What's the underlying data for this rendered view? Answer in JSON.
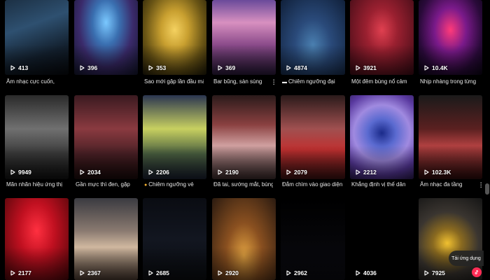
{
  "tiles": [
    {
      "views": "413",
      "caption": "Âm nhạc cực cuốn,",
      "caption_icon": "",
      "bg": "linear-gradient(160deg,#1c3044 0%,#2e5070 35%,#13202e 70%,#07090d 100%)"
    },
    {
      "views": "396",
      "caption": "",
      "caption_icon": "",
      "bg": "radial-gradient(ellipse at 50% 30%,#7ac8ff 0%,#3a6fb0 30%,#3a2a6a 60%,#12152a 100%)"
    },
    {
      "views": "353",
      "caption": "Sao mới gặp lần đầu mà",
      "caption_icon": "",
      "bg": "radial-gradient(ellipse at 50% 40%,#f4d160 0%,#c9a030 30%,#6a5515 65%,#1f1a08 100%)"
    },
    {
      "views": "369",
      "caption": "Bar bũng, sàn sùng",
      "caption_icon": "",
      "bg": "linear-gradient(180deg,#6a4a9a 0%,#d890c0 30%,#8a4a8a 60%,#2a1a3a 100%)"
    },
    {
      "views": "4874",
      "caption": "Chiêm ngưỡng đại",
      "caption_icon": "club",
      "bg": "radial-gradient(ellipse at 50% 60%,#4a7fb0 0%,#2a4a7a 40%,#10203a 100%)"
    },
    {
      "views": "3921",
      "caption": "Một đêm bùng nổ cảm",
      "caption_icon": "",
      "bg": "radial-gradient(ellipse at 50% 40%,#e04050 0%,#9a2030 35%,#3a0a14 100%)"
    },
    {
      "views": "10.4K",
      "caption": "Nhịp nhàng trong từng",
      "caption_icon": "",
      "bg": "radial-gradient(ellipse at 50% 40%,#ff3a7a 0%,#7a1a8a 35%,#2a0a3a 70%,#0a0412 100%)"
    },
    {
      "views": "9949",
      "caption": "Mãn nhãn hiệu ứng thị",
      "caption_icon": "",
      "bg": "linear-gradient(180deg,#2a2a2a 0%,#707070 40%,#3a3a3a 70%,#111 100%)"
    },
    {
      "views": "2034",
      "caption": "Gần mực thì đen, gặp",
      "caption_icon": "",
      "bg": "linear-gradient(180deg,#3a1a20 0%,#8a3a40 40%,#4a2025 70%,#1a0a0a 100%)"
    },
    {
      "views": "2206",
      "caption": "Chiêm ngưỡng vẻ",
      "caption_icon": "emoji",
      "bg": "linear-gradient(180deg,#2a3550 0%,#c8d060 40%,#4a6040 70%,#1a2030 100%)"
    },
    {
      "views": "2190",
      "caption": "Đã tai, sướng mắt, bùng",
      "caption_icon": "",
      "bg": "linear-gradient(180deg,#2a1a1a 0%,#8a4040 35%,#d0a0a0 60%,#3a2a2a 100%)"
    },
    {
      "views": "2079",
      "caption": "Đắm chìm vào giao diện",
      "caption_icon": "",
      "bg": "linear-gradient(180deg,#2a1a1a 0%,#a05050 40%,#c03030 65%,#3a1010 100%)"
    },
    {
      "views": "2212",
      "caption": "Khẳng định vị thế dân",
      "caption_icon": "",
      "bg": "radial-gradient(circle at 50% 45%,#1a2a8a 0%,#5a6ad0 25%,#a08ae0 50%,#5a3aa0 75%,#2a1a50 100%)"
    },
    {
      "views": "102.3K",
      "caption": "Âm nhạc đa tầng",
      "caption_icon": "",
      "bg": "linear-gradient(180deg,#1a1a1a 0%,#5a2020 40%,#b04040 60%,#2a0a0a 100%)"
    },
    {
      "views": "2177",
      "caption": "",
      "caption_icon": "",
      "bg": "radial-gradient(ellipse at 50% 40%,#ff3040 0%,#c01020 40%,#4a0508 100%)"
    },
    {
      "views": "2367",
      "caption": "",
      "caption_icon": "",
      "bg": "linear-gradient(180deg,#3a3a40 0%,#8a7a70 40%,#d0b8a0 60%,#4a3a30 100%)"
    },
    {
      "views": "2685",
      "caption": "",
      "caption_icon": "",
      "bg": "linear-gradient(180deg,#0a0c12 0%,#121620 50%,#0a0c10 100%)"
    },
    {
      "views": "2920",
      "caption": "",
      "caption_icon": "",
      "bg": "radial-gradient(ellipse at 50% 70%,#e0a040 0%,#8a5020 40%,#2a1a10 100%)"
    },
    {
      "views": "2962",
      "caption": "",
      "caption_icon": "",
      "bg": "linear-gradient(180deg,#000 0%,#050508 50%,#0a0a10 100%)"
    },
    {
      "views": "4036",
      "caption": "",
      "caption_icon": "",
      "bg": "linear-gradient(180deg,#000 0%,#000 100%)"
    },
    {
      "views": "7925",
      "caption": "",
      "caption_icon": "",
      "bg": "radial-gradient(circle at 45% 55%,#f0c030 0%,#8a6a20 25%,#3a3530 55%,#151515 100%)"
    }
  ],
  "download": {
    "label": "Tải ứng dụng"
  },
  "colors": {
    "accent": "#fe2c55"
  }
}
